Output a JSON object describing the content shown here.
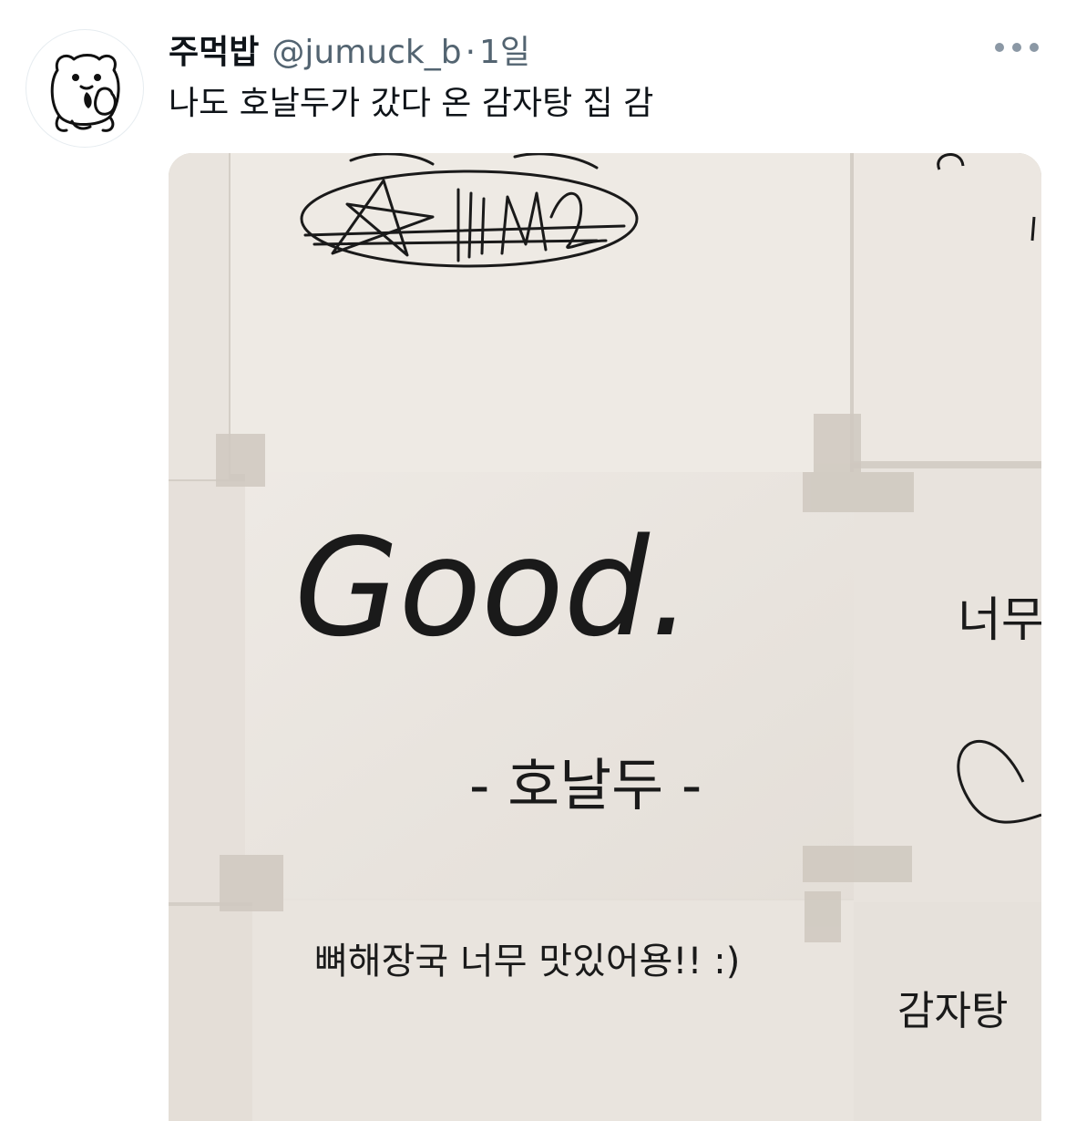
{
  "user": {
    "display_name": "주먹밥",
    "handle": "@jumuck_b",
    "separator": "·",
    "time": "1일"
  },
  "tweet": {
    "text": "나도 호날두가 갔다 온 감자탕 집 감"
  },
  "icons": {
    "avatar": "bear-illustration-avatar",
    "more": "more-dots-icon"
  },
  "photo": {
    "notes": {
      "good": "Good.",
      "signature_name": "- 호날두 -",
      "soup_note": "뼈해장국 너무 맛있어용!! :)",
      "right_top": "너무",
      "right_bottom": "감자탕"
    }
  },
  "colors": {
    "text": "#0f1419",
    "secondary": "#536471",
    "paper": "#ede8e2"
  }
}
